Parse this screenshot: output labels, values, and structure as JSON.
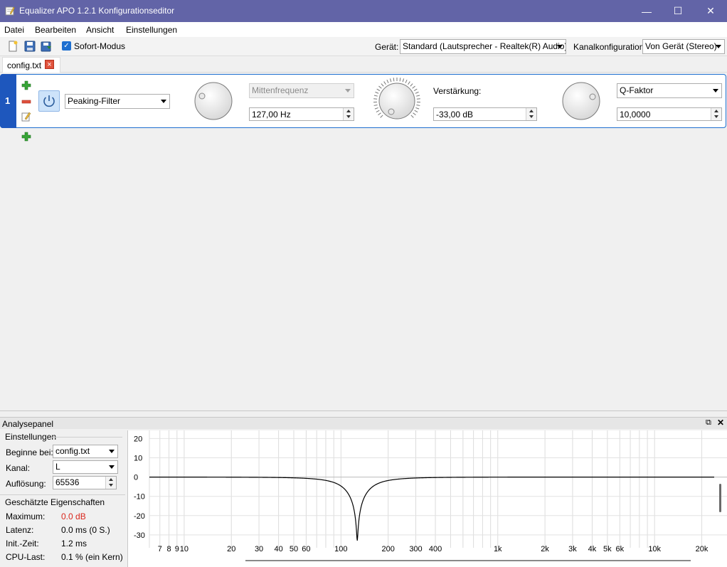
{
  "window": {
    "title": "Equalizer APO 1.2.1 Konfigurationseditor",
    "minimize": "—",
    "maximize": "☐",
    "close": "✕"
  },
  "menu": [
    "Datei",
    "Bearbeiten",
    "Ansicht",
    "Einstellungen"
  ],
  "toolbar": {
    "sofort_label": "Sofort-Modus",
    "sofort_checked": true,
    "device_label": "Gerät:",
    "device_value": "Standard (Lautsprecher - Realtek(R) Audio)",
    "channel_label": "Kanalkonfiguration:",
    "channel_value": "Von Gerät (Stereo)"
  },
  "tabs": [
    {
      "label": "config.txt"
    }
  ],
  "filter": {
    "index": "1",
    "type": "Peaking-Filter",
    "freq_mode": "Mittenfrequenz",
    "freq_value": "127,00 Hz",
    "gain_label": "Verstärkung:",
    "gain_value": "-33,00 dB",
    "q_mode": "Q-Faktor",
    "q_value": "10,0000"
  },
  "analysis": {
    "panel_title": "Analysepanel",
    "settings_title": "Einstellungen",
    "start_label": "Beginne bei:",
    "start_value": "config.txt",
    "channel_label": "Kanal:",
    "channel_value": "L",
    "resolution_label": "Auflösung:",
    "resolution_value": "65536",
    "props_title": "Geschätzte Eigenschaften",
    "max_label": "Maximum:",
    "max_value": "0.0 dB",
    "latency_label": "Latenz:",
    "latency_value": "0.0 ms (0 S.)",
    "init_label": "Init.-Zeit:",
    "init_value": "1.2 ms",
    "cpu_label": "CPU-Last:",
    "cpu_value": "0.1 % (ein Kern)"
  },
  "colors": {
    "titlebar": "#6264a7",
    "accent": "#1e57bd",
    "max_value": "#d9261c"
  },
  "chart_data": {
    "type": "line",
    "y_ticks": [
      20,
      10,
      0,
      -10,
      -20,
      -30
    ],
    "x_ticks": [
      "7",
      "8",
      "9",
      "10",
      "20",
      "30",
      "40",
      "50",
      "60",
      "100",
      "200",
      "300",
      "400",
      "1k",
      "2k",
      "3k",
      "4k",
      "5k",
      "6k",
      "10k",
      "20k"
    ],
    "x_tick_values": [
      7,
      8,
      9,
      10,
      20,
      30,
      40,
      50,
      60,
      100,
      200,
      300,
      400,
      1000,
      2000,
      3000,
      4000,
      5000,
      6000,
      10000,
      20000
    ],
    "x_scale": "log",
    "ylim": [
      -33,
      22
    ],
    "xlim": [
      6,
      24000
    ],
    "filter": {
      "type": "peaking",
      "fc": 127,
      "gain_db": -33,
      "q": 10
    },
    "grid": true
  }
}
